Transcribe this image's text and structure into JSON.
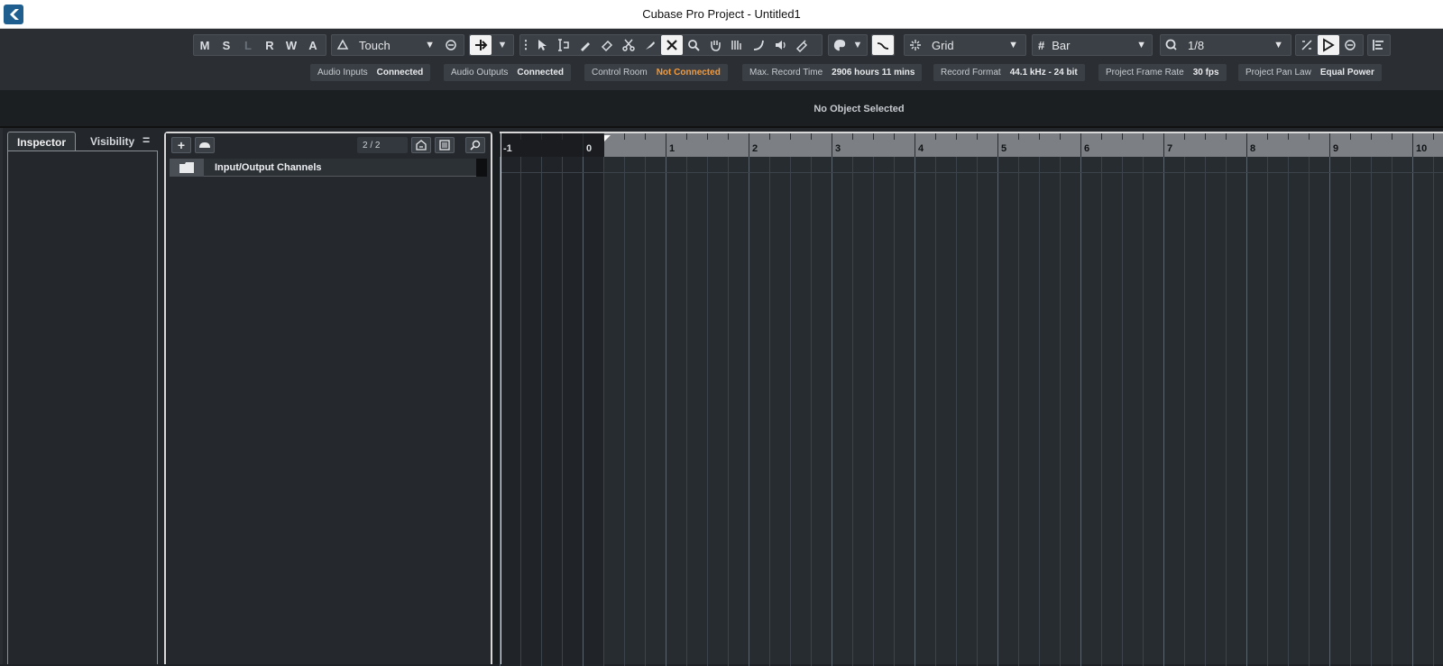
{
  "window": {
    "title": "Cubase Pro Project - Untitled1",
    "app_icon": "cubase-logo-icon"
  },
  "toolbar": {
    "automation_modes": [
      "M",
      "S",
      "L",
      "R",
      "W",
      "A"
    ],
    "automation_dim": "L",
    "automation_mode_value": "Touch",
    "grid_type": "Grid",
    "grid_type_icon": "snap-icon",
    "grid_value": "Bar",
    "quantize_value": "1/8",
    "quantize_prefix": "Q",
    "grid_prefix": "#",
    "tools": [
      "object-select-icon",
      "range-select-icon",
      "draw-icon",
      "erase-icon",
      "split-icon",
      "glue-icon",
      "mute-icon",
      "zoom-icon",
      "hand-icon",
      "comp-icon",
      "timewarp-icon",
      "speaker-icon",
      "color-icon"
    ]
  },
  "status": {
    "items": [
      {
        "key": "Audio Inputs",
        "value": "Connected",
        "warn": false
      },
      {
        "key": "Audio Outputs",
        "value": "Connected",
        "warn": false
      },
      {
        "key": "Control Room",
        "value": "Not Connected",
        "warn": true
      },
      {
        "key": "Max. Record Time",
        "value": "2906 hours 11 mins",
        "warn": false
      },
      {
        "key": "Record Format",
        "value": "44.1 kHz - 24 bit",
        "warn": false
      },
      {
        "key": "Project Frame Rate",
        "value": "30 fps",
        "warn": false
      },
      {
        "key": "Project Pan Law",
        "value": "Equal Power",
        "warn": false
      }
    ],
    "warn_color": "#f39a3b"
  },
  "info_line": {
    "text": "No Object Selected"
  },
  "left_zone": {
    "tabs": [
      "Inspector",
      "Visibility"
    ],
    "active_tab": "Inspector",
    "menu_glyph": "="
  },
  "track_list": {
    "add_glyph": "+",
    "track_count": "2 / 2",
    "tracks": [
      {
        "name": "Input/Output Channels",
        "type": "folder"
      }
    ]
  },
  "ruler": {
    "bars": [
      "-1",
      "0",
      "1",
      "2",
      "3",
      "4",
      "5",
      "6",
      "7",
      "8",
      "9",
      "10"
    ]
  }
}
